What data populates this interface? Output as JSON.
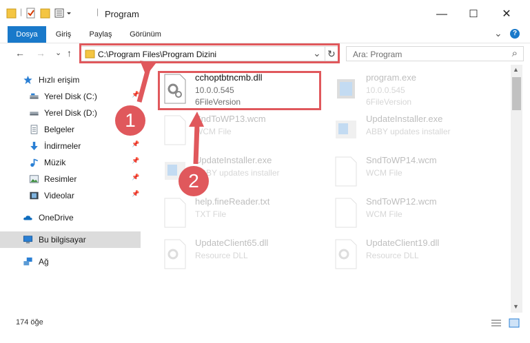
{
  "window": {
    "title": "Program",
    "minimize_glyph": "—",
    "maximize_glyph": "☐",
    "close_glyph": "✕"
  },
  "ribbon": {
    "tabs": [
      {
        "label": "Dosya"
      },
      {
        "label": "Giriş"
      },
      {
        "label": "Paylaş"
      },
      {
        "label": "Görünüm"
      }
    ],
    "collapse_glyph": "⌄",
    "help_glyph": "?"
  },
  "nav": {
    "back_glyph": "←",
    "forward_glyph": "→",
    "recent_glyph": "⌄",
    "up_glyph": "↑"
  },
  "address": {
    "path": "C:\\Program Files\\Program Dizini",
    "dropdown_glyph": "⌄",
    "refresh_glyph": "↻"
  },
  "search": {
    "placeholder": "Ara: Program",
    "icon_glyph": "⌕"
  },
  "sidebar": {
    "items": [
      {
        "label": "Hızlı erişim",
        "icon": "star-icon"
      },
      {
        "label": "Yerel Disk (C:)",
        "icon": "drive-icon"
      },
      {
        "label": "Yerel Disk (D:)",
        "icon": "drive-icon"
      },
      {
        "label": "Belgeler",
        "icon": "documents-icon"
      },
      {
        "label": "İndirmeler",
        "icon": "download-icon"
      },
      {
        "label": "Müzik",
        "icon": "music-icon"
      },
      {
        "label": "Resimler",
        "icon": "pictures-icon"
      },
      {
        "label": "Videolar",
        "icon": "videos-icon"
      },
      {
        "label": "OneDrive",
        "icon": "cloud-icon"
      },
      {
        "label": "Bu bilgisayar",
        "icon": "computer-icon"
      },
      {
        "label": "Ağ",
        "icon": "network-icon"
      }
    ]
  },
  "files": [
    {
      "name": "cchoptbtncmb.dll",
      "line1": "10.0.0.545",
      "line2": "6FileVersion",
      "icon": "dll-gear-icon"
    },
    {
      "name": "program.exe",
      "line1": "10.0.0.545",
      "line2": "6FileVersion",
      "icon": "exe-icon"
    },
    {
      "name": "SndToWP13.wcm",
      "line1": "WCM File",
      "line2": "",
      "icon": "document-icon"
    },
    {
      "name": "UpdateInstaller.exe",
      "line1": "ABBY updates installer",
      "line2": "",
      "icon": "installer-icon"
    },
    {
      "name": "UpdateInstaller.exe",
      "line1": "ABBY updates installer",
      "line2": "",
      "icon": "installer-icon"
    },
    {
      "name": "SndToWP14.wcm",
      "line1": "WCM File",
      "line2": "",
      "icon": "document-icon"
    },
    {
      "name": "help.fineReader.txt",
      "line1": "TXT File",
      "line2": "",
      "icon": "document-icon"
    },
    {
      "name": "SndToWP12.wcm",
      "line1": "WCM File",
      "line2": "",
      "icon": "document-icon"
    },
    {
      "name": "UpdateClient65.dll",
      "line1": "Resource DLL",
      "line2": "",
      "icon": "dll-gear-icon"
    },
    {
      "name": "UpdateClient19.dll",
      "line1": "Resource DLL",
      "line2": "",
      "icon": "dll-gear-icon"
    }
  ],
  "status": {
    "item_count": "174 öğe"
  },
  "annotations": {
    "step1": "1",
    "step2": "2",
    "highlight_color": "#e0585c"
  },
  "colors": {
    "file_tab": "#1979ca",
    "folder": "#f4c542",
    "selected_nav": "#dcdcdc"
  }
}
